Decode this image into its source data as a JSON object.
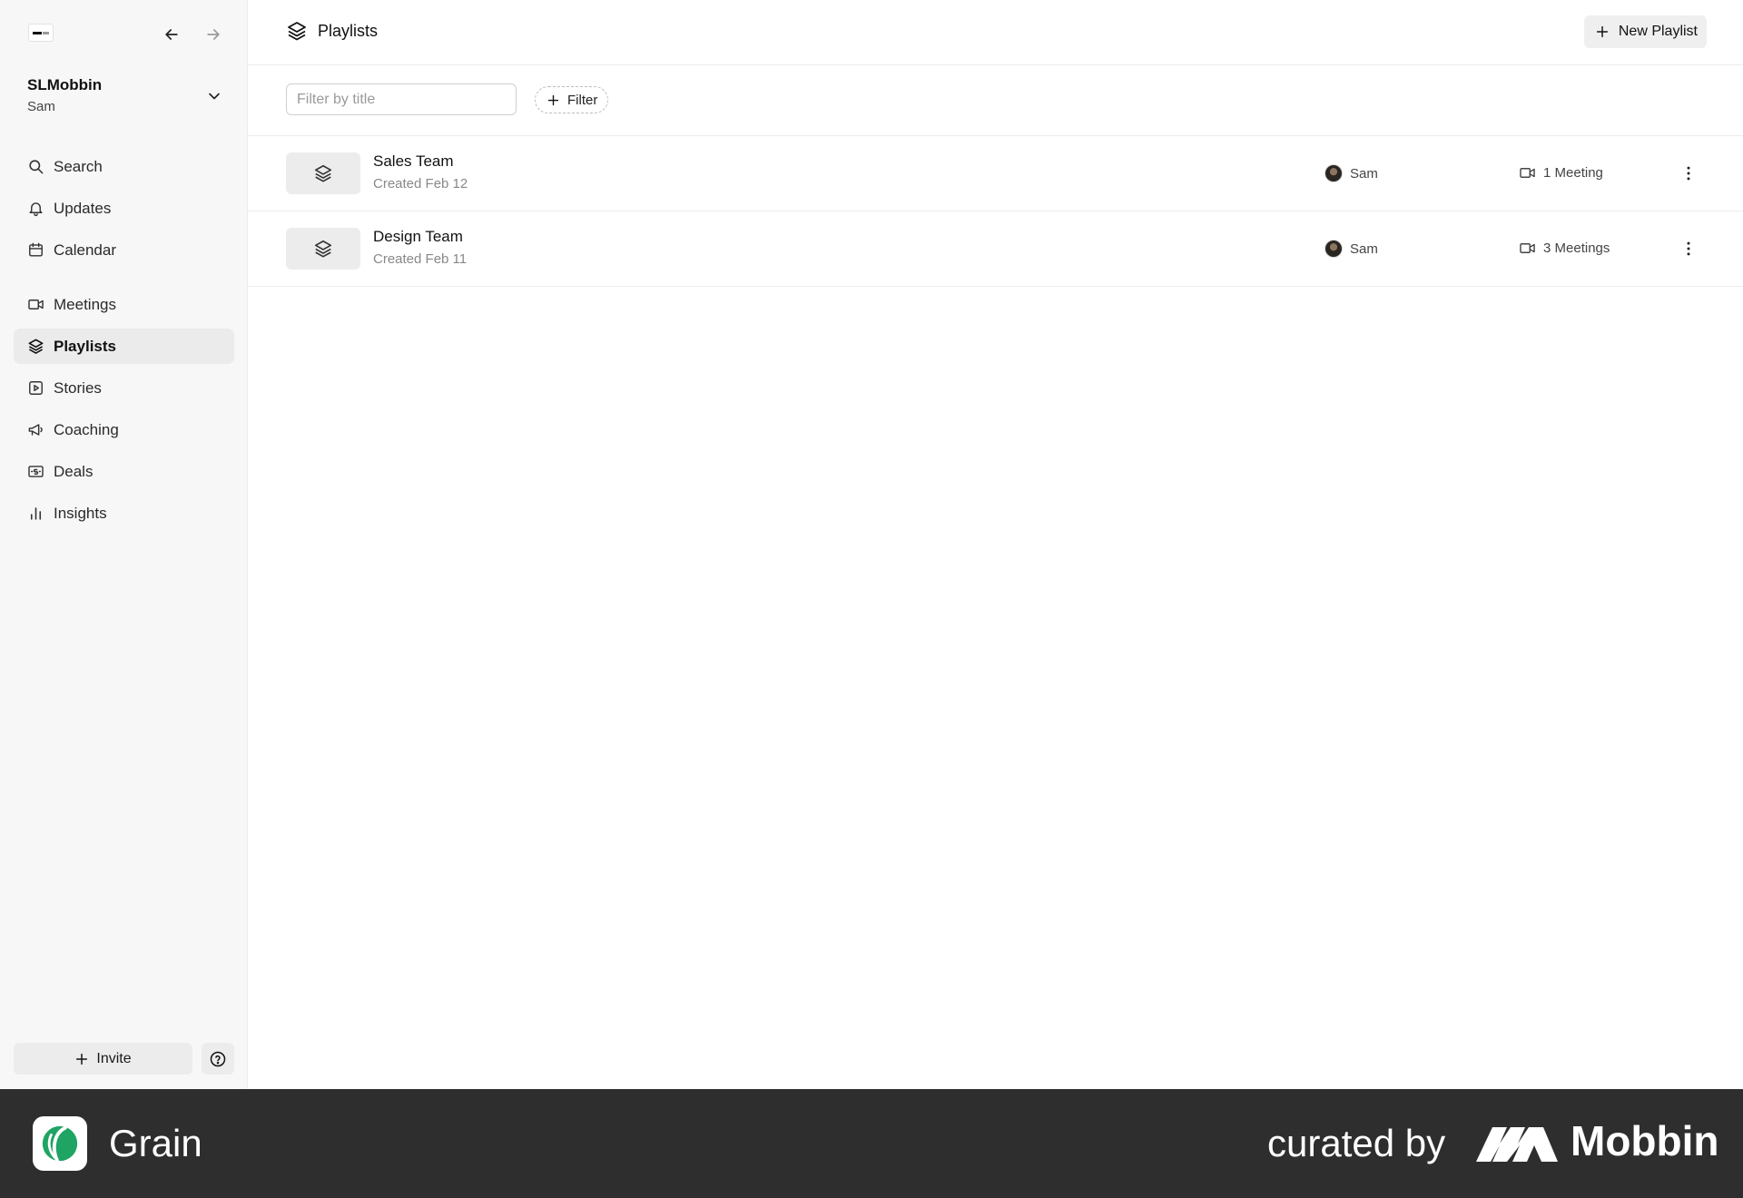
{
  "sidebar": {
    "workspace_name": "SLMobbin",
    "workspace_user": "Sam",
    "nav_primary": [
      {
        "label": "Search",
        "icon": "search-icon"
      },
      {
        "label": "Updates",
        "icon": "bell-icon"
      },
      {
        "label": "Calendar",
        "icon": "calendar-icon"
      }
    ],
    "nav_secondary": [
      {
        "label": "Meetings",
        "icon": "video-icon"
      },
      {
        "label": "Playlists",
        "icon": "layers-icon",
        "active": true
      },
      {
        "label": "Stories",
        "icon": "play-square-icon"
      },
      {
        "label": "Coaching",
        "icon": "megaphone-icon"
      },
      {
        "label": "Deals",
        "icon": "deals-icon"
      },
      {
        "label": "Insights",
        "icon": "bar-chart-icon"
      }
    ],
    "invite_label": "Invite"
  },
  "header": {
    "title": "Playlists",
    "new_button_label": "New Playlist"
  },
  "filters": {
    "search_placeholder": "Filter by title",
    "search_value": "",
    "filter_label": "Filter"
  },
  "playlists": [
    {
      "title": "Sales Team",
      "created": "Created Feb 12",
      "owner": "Sam",
      "meetings": "1 Meeting"
    },
    {
      "title": "Design Team",
      "created": "Created Feb 11",
      "owner": "Sam",
      "meetings": "3 Meetings"
    }
  ],
  "footer": {
    "brand": "Grain",
    "curated_by": "curated by",
    "curator": "Mobbin"
  },
  "colors": {
    "sidebar_bg": "#f7f7f7",
    "active_item_bg": "#ebebeb",
    "footer_bg": "#2e2e2e",
    "grain_green": "#1fa463"
  }
}
